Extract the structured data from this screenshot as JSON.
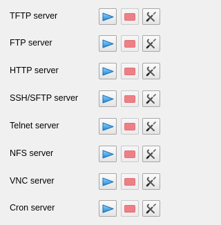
{
  "services": [
    {
      "name": "TFTP server"
    },
    {
      "name": "FTP server"
    },
    {
      "name": "HTTP server"
    },
    {
      "name": "SSH/SFTP server"
    },
    {
      "name": "Telnet server"
    },
    {
      "name": "NFS server"
    },
    {
      "name": "VNC server"
    },
    {
      "name": "Cron server"
    }
  ],
  "icons": {
    "start": "play-icon",
    "stop": "stop-icon",
    "settings": "tools-icon"
  },
  "colors": {
    "play_fill": "#3aa0e8",
    "stop_fill": "#ef7f86",
    "background": "#f0f0f0"
  }
}
